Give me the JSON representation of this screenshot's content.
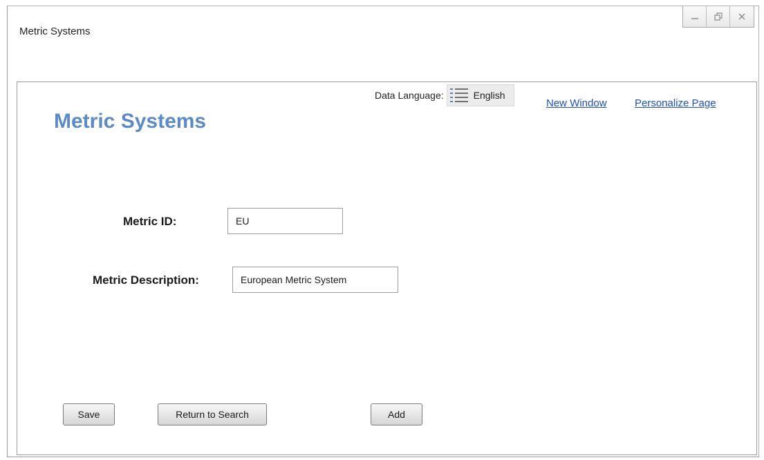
{
  "window": {
    "title": "Metric Systems",
    "controls": {
      "minimize_icon": "minimize-icon",
      "restore_icon": "restore-icon",
      "close_icon": "close-icon"
    }
  },
  "header": {
    "data_language_label": "Data Language:",
    "data_language_value": "English",
    "data_language_icon": "list-icon",
    "new_window_link": "New Window",
    "personalize_link": "Personalize Page"
  },
  "page": {
    "title": "Metric Systems"
  },
  "form": {
    "metric_id": {
      "label": "Metric ID:",
      "value": "EU"
    },
    "metric_description": {
      "label": "Metric Description:",
      "value": "European Metric System"
    }
  },
  "buttons": {
    "save": "Save",
    "return_to_search": "Return to Search",
    "add": "Add"
  },
  "colors": {
    "page_title": "#5b8ac6",
    "link": "#1e4fc4"
  }
}
